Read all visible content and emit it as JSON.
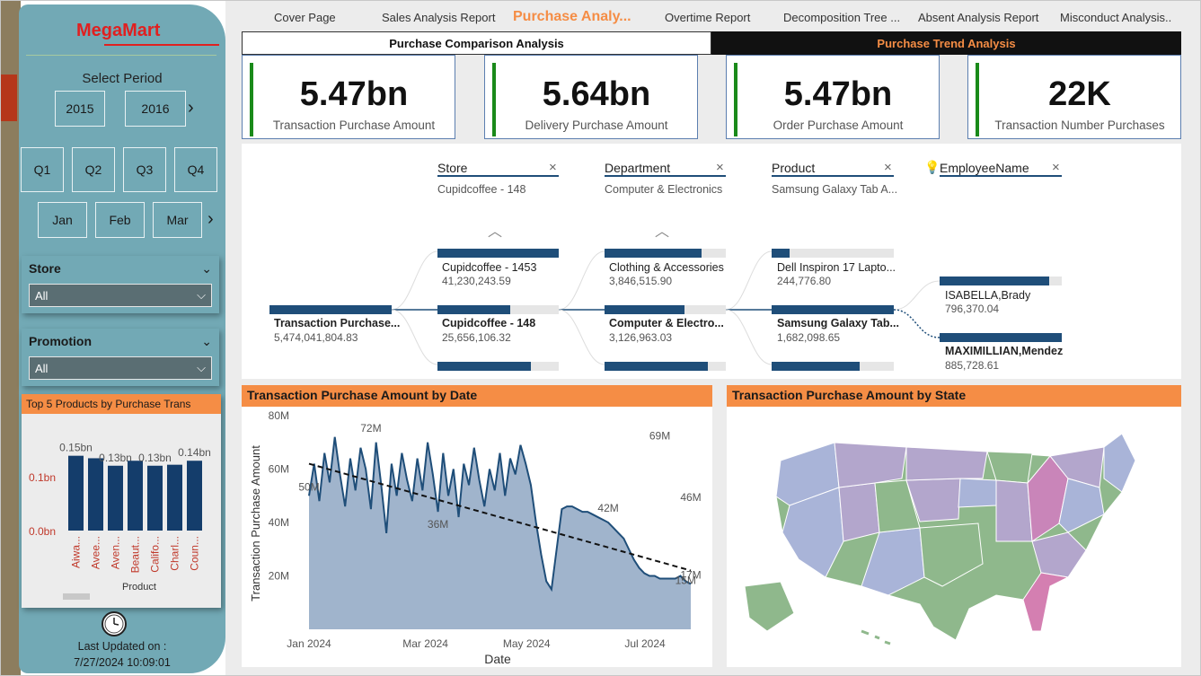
{
  "sidebar": {
    "brand": "MegaMart",
    "select_period_label": "Select Period",
    "years": [
      "2015",
      "2016"
    ],
    "quarters": [
      "Q1",
      "Q2",
      "Q3",
      "Q4"
    ],
    "months": [
      "Jan",
      "Feb",
      "Mar"
    ],
    "store_slicer": {
      "label": "Store",
      "value": "All"
    },
    "promotion_slicer": {
      "label": "Promotion",
      "value": "All"
    },
    "top5": {
      "title": "Top 5 Products by Purchase Trans",
      "xlabel": "Product",
      "chart_data": {
        "type": "bar",
        "categories": [
          "Aiwa...",
          "Avee...",
          "Aven...",
          "Beaut...",
          "Califo...",
          "Charl...",
          "Coun..."
        ],
        "values": [
          0.15,
          0.145,
          0.13,
          0.14,
          0.13,
          0.132,
          0.14
        ],
        "data_labels": [
          "0.15bn",
          "",
          "0.13bn",
          "",
          "0.13bn",
          "",
          "0.14bn"
        ],
        "yticks": [
          "0.1bn",
          "0.0bn"
        ],
        "ylim": [
          0,
          0.18
        ]
      }
    },
    "last_updated_label": "Last Updated on :",
    "last_updated_value": "7/27/2024 10:09:01"
  },
  "tabs": [
    {
      "label": "Cover Page",
      "active": false
    },
    {
      "label": "Sales Analysis Report",
      "active": false
    },
    {
      "label": "Purchase Analy...",
      "active": true
    },
    {
      "label": "Overtime Report",
      "active": false
    },
    {
      "label": "Decomposition Tree ...",
      "active": false
    },
    {
      "label": "Absent Analysis Report",
      "active": false
    },
    {
      "label": "Misconduct Analysis..",
      "active": false
    }
  ],
  "subtabs": {
    "left": "Purchase Comparison Analysis",
    "right": "Purchase Trend Analysis"
  },
  "kpis": [
    {
      "value": "5.47bn",
      "label": "Transaction Purchase Amount"
    },
    {
      "value": "5.64bn",
      "label": "Delivery Purchase Amount"
    },
    {
      "value": "5.47bn",
      "label": "Order Purchase Amount"
    },
    {
      "value": "22K",
      "label": "Transaction Number Purchases"
    }
  ],
  "decomp": {
    "levels": [
      {
        "title": "Store",
        "sub": "Cupidcoffee - 148"
      },
      {
        "title": "Department",
        "sub": "Computer & Electronics"
      },
      {
        "title": "Product",
        "sub": "Samsung Galaxy Tab A..."
      },
      {
        "title": "EmployeeName",
        "sub": ""
      }
    ],
    "root": {
      "label": "Transaction Purchase...",
      "value": "5,474,041,804.83"
    },
    "store_nodes": [
      {
        "label": "Cupidcoffee - 1453",
        "value": "41,230,243.59",
        "fill": 1.0
      },
      {
        "label": "Cupidcoffee - 148",
        "value": "25,656,106.32",
        "fill": 0.6,
        "selected": true
      },
      {
        "label": "",
        "value": "",
        "fill": 0.77
      }
    ],
    "dept_nodes": [
      {
        "label": "Clothing & Accessories",
        "value": "3,846,515.90",
        "fill": 0.8
      },
      {
        "label": "Computer & Electro...",
        "value": "3,126,963.03",
        "fill": 0.66,
        "selected": true
      },
      {
        "label": "",
        "value": "",
        "fill": 0.85
      }
    ],
    "product_nodes": [
      {
        "label": "Dell Inspiron 17 Lapto...",
        "value": "244,776.80",
        "fill": 0.15
      },
      {
        "label": "Samsung Galaxy Tab...",
        "value": "1,682,098.65",
        "fill": 1.0,
        "selected": true
      },
      {
        "label": "",
        "value": "",
        "fill": 0.72
      }
    ],
    "employee_nodes": [
      {
        "label": "ISABELLA,Brady",
        "value": "796,370.04",
        "fill": 0.9
      },
      {
        "label": "MAXIMILLIAN,Mendez",
        "value": "885,728.61",
        "fill": 1.0,
        "selected": true
      }
    ]
  },
  "line_chart": {
    "title": "Transaction Purchase Amount by Date",
    "chart_data": {
      "type": "area",
      "xlabel": "Date",
      "ylabel": "Transaction Purchase Amount",
      "yticks": [
        "80M",
        "60M",
        "40M",
        "20M"
      ],
      "xticks": [
        "Jan 2024",
        "Mar 2024",
        "May 2024",
        "Jul 2024"
      ],
      "ylim": [
        0,
        80
      ],
      "annotations": [
        {
          "label": "72M",
          "x": 12,
          "y": 72
        },
        {
          "label": "50M",
          "x": 0,
          "y": 50
        },
        {
          "label": "36M",
          "x": 25,
          "y": 36
        },
        {
          "label": "69M",
          "x": 68,
          "y": 69
        },
        {
          "label": "42M",
          "x": 58,
          "y": 42
        },
        {
          "label": "46M",
          "x": 78,
          "y": 46
        },
        {
          "label": "15M",
          "x": 73,
          "y": 15
        },
        {
          "label": "17M",
          "x": 150,
          "y": 17
        }
      ],
      "values": [
        50,
        62,
        48,
        66,
        55,
        72,
        58,
        46,
        64,
        52,
        68,
        60,
        45,
        70,
        54,
        36,
        62,
        50,
        66,
        56,
        48,
        64,
        52,
        70,
        58,
        44,
        66,
        50,
        60,
        42,
        62,
        54,
        68,
        56,
        46,
        60,
        52,
        66,
        50,
        64,
        58,
        69,
        62,
        54,
        40,
        28,
        18,
        15,
        30,
        45,
        46,
        46,
        45,
        44,
        44,
        43,
        42,
        41,
        40,
        38,
        36,
        34,
        30,
        26,
        23,
        21,
        20,
        20,
        19,
        19,
        19,
        19,
        20,
        18,
        17
      ]
    }
  },
  "map": {
    "title": "Transaction Purchase Amount by State"
  },
  "colors": {
    "accent": "#f58d45",
    "navy": "#1f4e79",
    "teal": "#72a9b5"
  }
}
